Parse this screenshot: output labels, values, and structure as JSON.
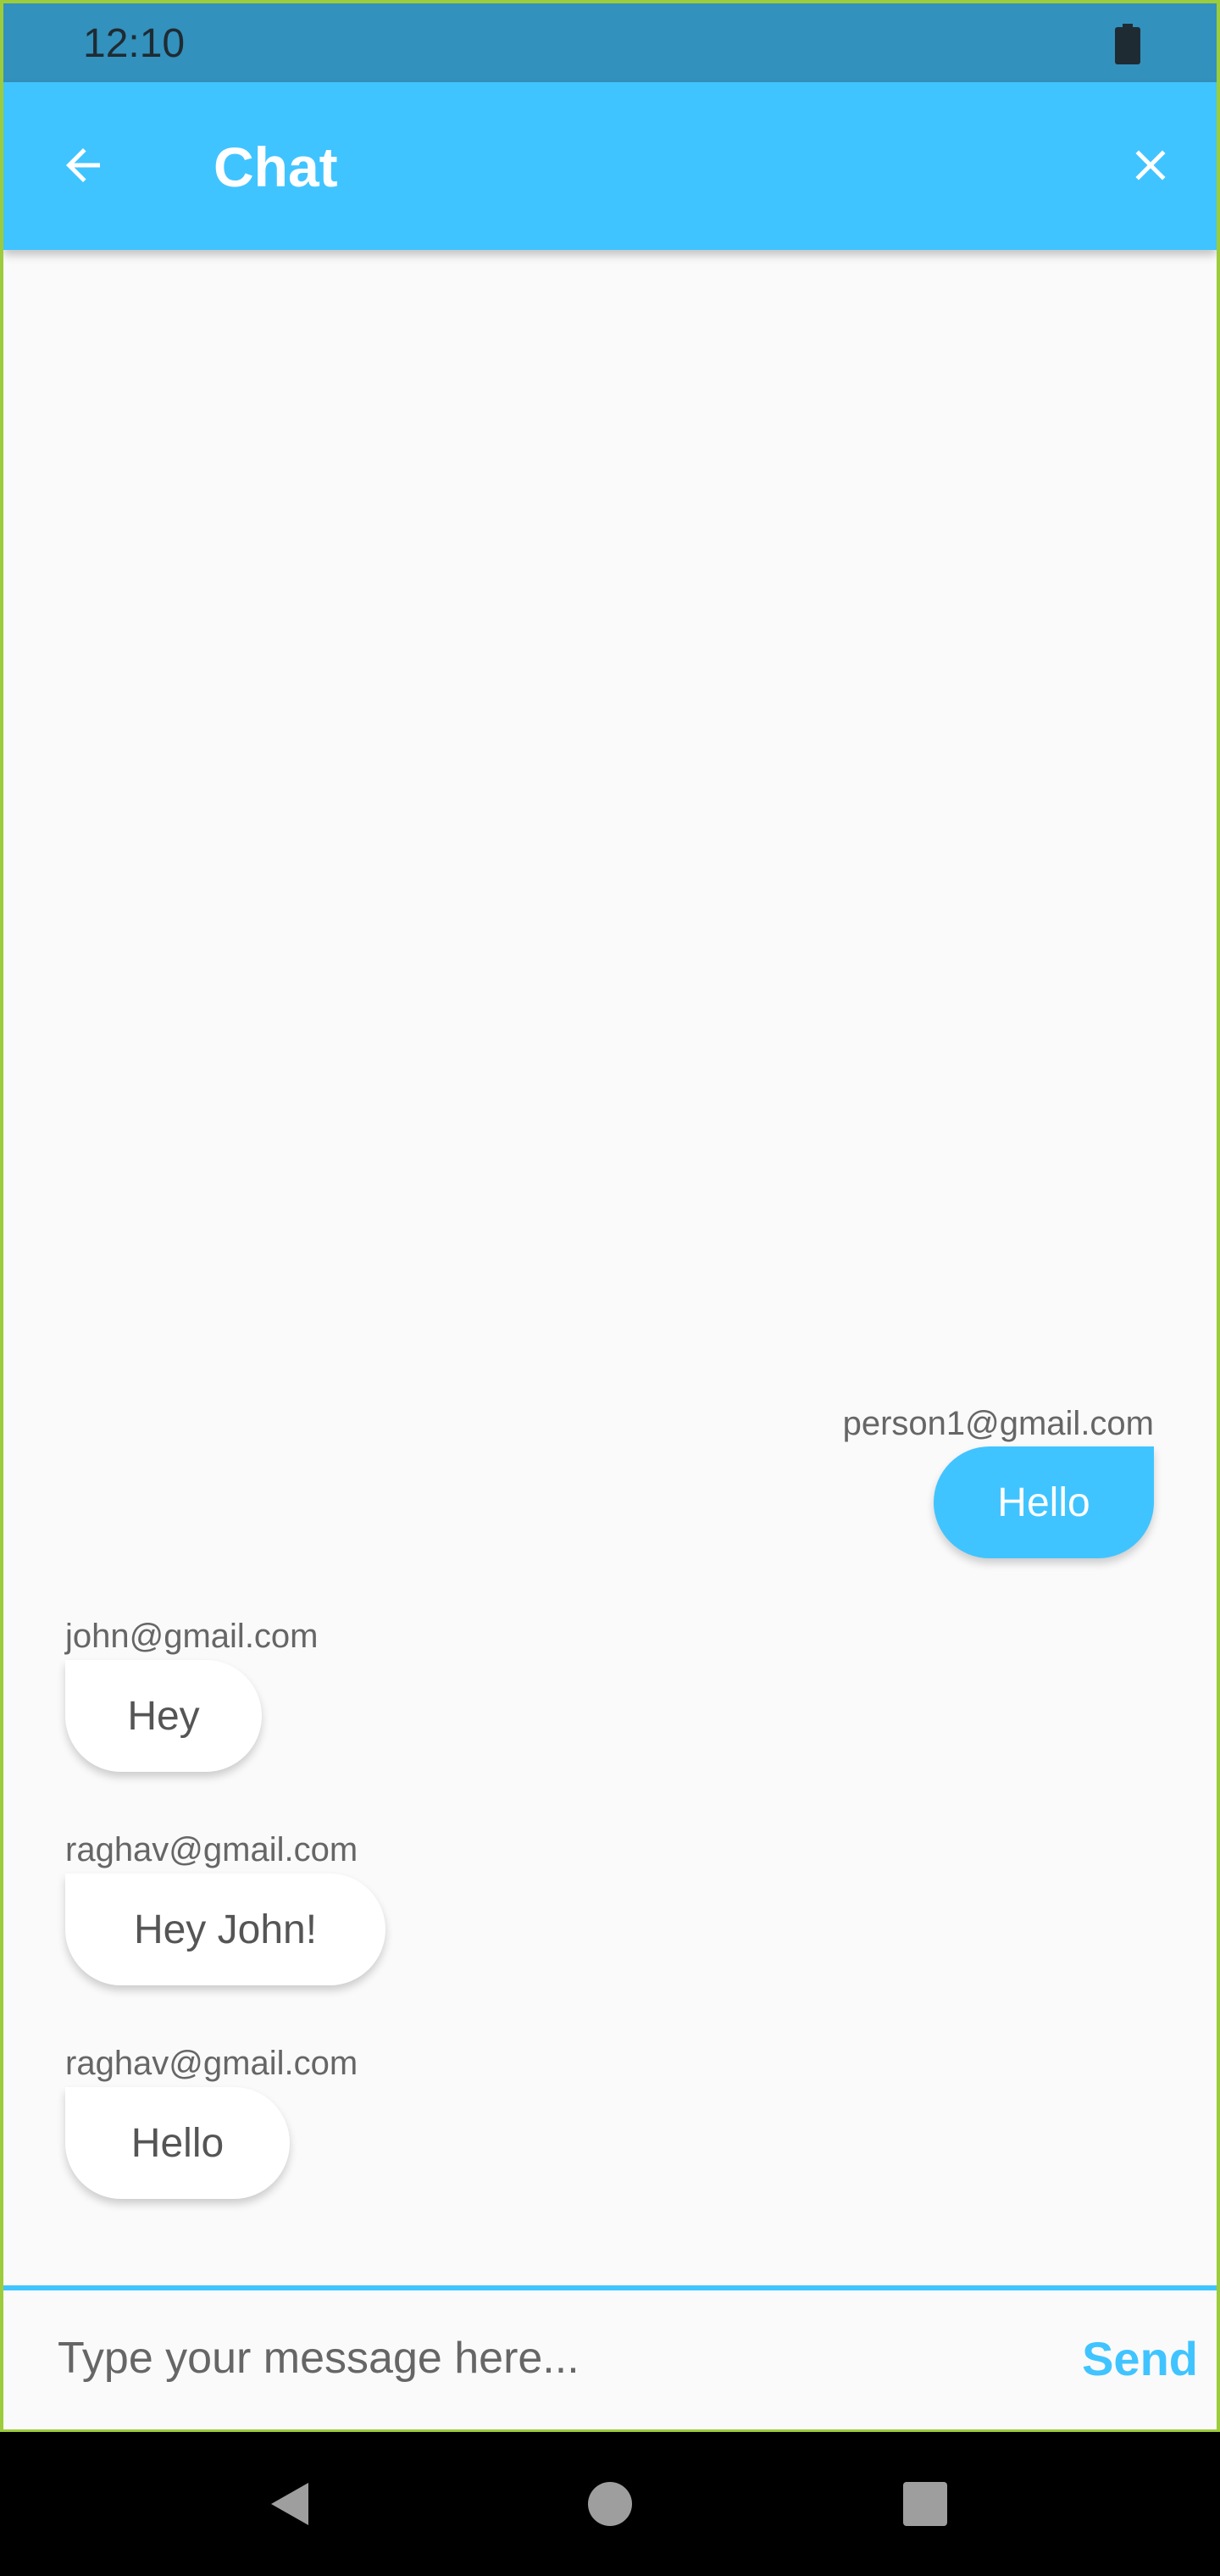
{
  "status_bar": {
    "time": "12:10",
    "icons": [
      "battery-icon"
    ]
  },
  "app_bar": {
    "title": "Chat",
    "back_icon": "arrow-back-icon",
    "close_icon": "close-icon"
  },
  "messages": [
    {
      "sender": "person1@gmail.com",
      "text": "Hello",
      "direction": "outgoing"
    },
    {
      "sender": "john@gmail.com",
      "text": "Hey",
      "direction": "incoming"
    },
    {
      "sender": "raghav@gmail.com",
      "text": "Hey John!",
      "direction": "incoming"
    },
    {
      "sender": "raghav@gmail.com",
      "text": "Hello",
      "direction": "incoming"
    }
  ],
  "composer": {
    "placeholder": "Type your message here...",
    "value": "",
    "send_label": "Send"
  },
  "nav_bar": {
    "icons": [
      "back-triangle-icon",
      "home-circle-icon",
      "recents-square-icon"
    ]
  },
  "colors": {
    "accent": "#40c4ff",
    "status_bar": "#3391bd",
    "background": "#fafafa",
    "incoming_bubble": "#ffffff",
    "frame_border": "#9ccc3c"
  }
}
